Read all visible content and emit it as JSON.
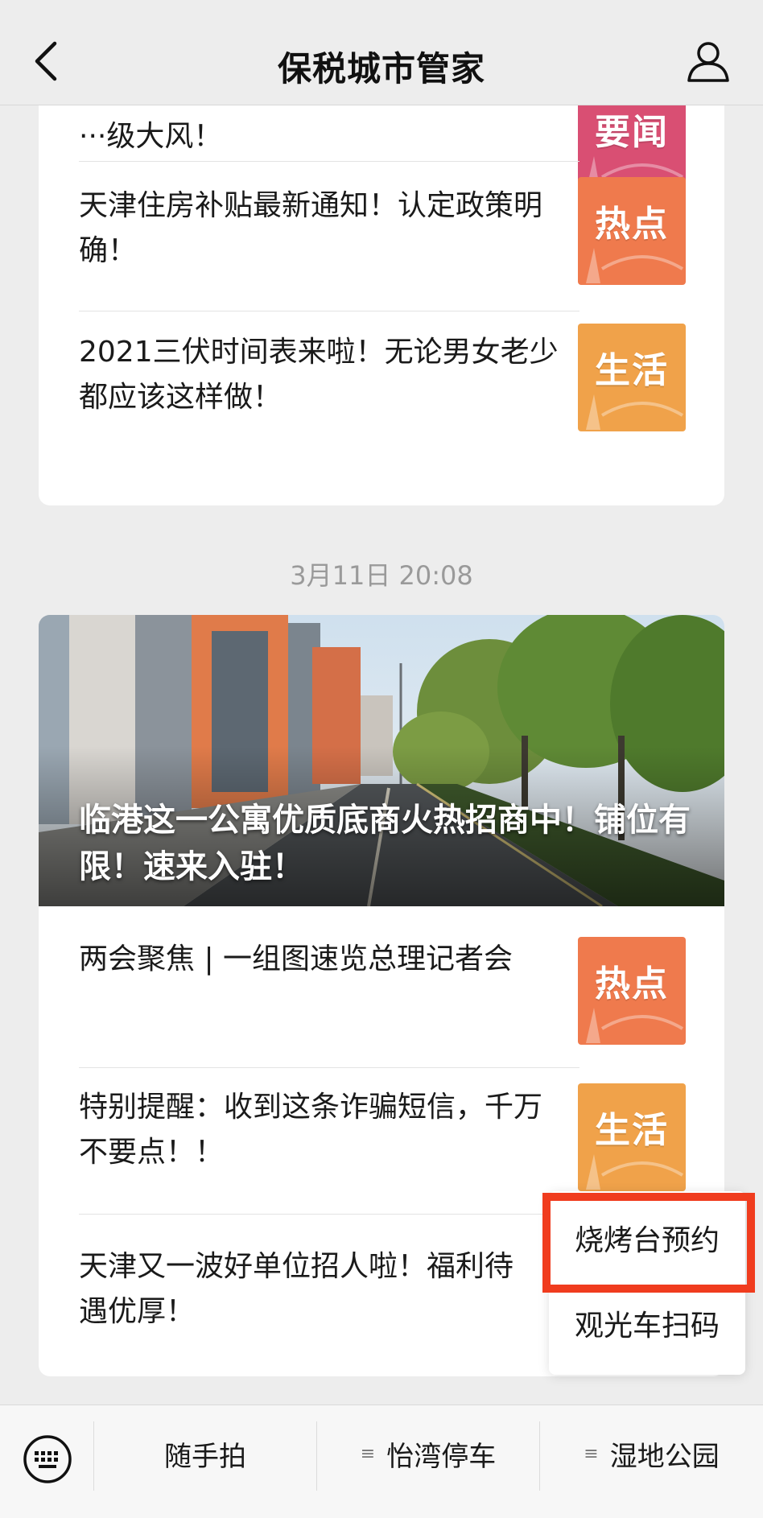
{
  "header": {
    "title": "保税城市管家",
    "back_icon": "chevron-left-icon",
    "profile_icon": "person-icon"
  },
  "group1": {
    "items": [
      {
        "title": "···级大风！",
        "thumb_label": "要闻",
        "thumb_color": "#d94f73"
      },
      {
        "title": "天津住房补贴最新通知！认定政策明确！",
        "thumb_label": "热点",
        "thumb_color": "#ef7a4d"
      },
      {
        "title": "2021三伏时间表来啦！无论男女老少都应该这样做！",
        "thumb_label": "生活",
        "thumb_color": "#f0a24a"
      }
    ]
  },
  "timestamp": "3月11日 20:08",
  "group2": {
    "hero_caption": "临港这一公寓优质底商火热招商中！铺位有限！速来入驻！",
    "items": [
      {
        "title": "两会聚焦 | 一组图速览总理记者会",
        "thumb_label": "热点",
        "thumb_color": "#ef7a4d"
      },
      {
        "title": "特别提醒：收到这条诈骗短信，千万不要点！！",
        "thumb_label": "生活",
        "thumb_color": "#f0a24a"
      },
      {
        "title": "天津又一波好单位招人啦！福利待遇优厚！"
      }
    ]
  },
  "popup_menu": {
    "items": [
      "烧烤台预约",
      "观光车扫码"
    ],
    "highlight_color": "#f03c1e"
  },
  "bottom_bar": {
    "keyboard_icon": "keyboard-icon",
    "menus": [
      "随手拍",
      "怡湾停车",
      "湿地公园"
    ],
    "menu_icon_glyph": "≡"
  }
}
